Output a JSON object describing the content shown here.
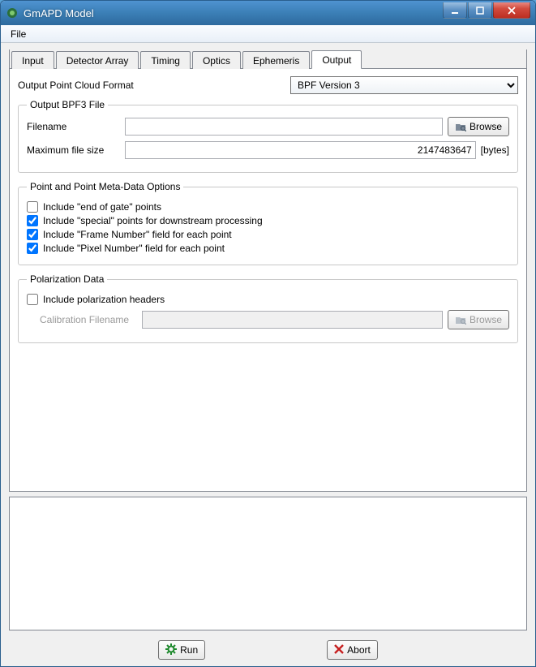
{
  "window": {
    "title": "GmAPD Model",
    "menu_file": "File"
  },
  "tabs": {
    "items": [
      "Input",
      "Detector Array",
      "Timing",
      "Optics",
      "Ephemeris",
      "Output"
    ],
    "active": "Output"
  },
  "output": {
    "format_label": "Output Point Cloud Format",
    "format_selected": "BPF Version 3",
    "bpf_group": "Output BPF3 File",
    "filename_label": "Filename",
    "filename_value": "",
    "browse_label": "Browse",
    "max_file_label": "Maximum file size",
    "max_file_value": "2147483647",
    "max_file_unit": "[bytes]",
    "meta_group": "Point and Point Meta-Data Options",
    "opt_end_of_gate": "Include \"end of gate\" points",
    "opt_special": "Include \"special\" points for downstream processing",
    "opt_frame": "Include \"Frame Number\" field for each point",
    "opt_pixel": "Include \"Pixel Number\" field for each point",
    "polar_group": "Polarization Data",
    "polar_include": "Include polarization headers",
    "calib_label": "Calibration Filename",
    "calib_value": "",
    "calib_browse": "Browse"
  },
  "footer": {
    "run_label": "Run",
    "abort_label": "Abort"
  },
  "checkbox_states": {
    "end_of_gate": false,
    "special": true,
    "frame": true,
    "pixel": true,
    "polar": false
  }
}
